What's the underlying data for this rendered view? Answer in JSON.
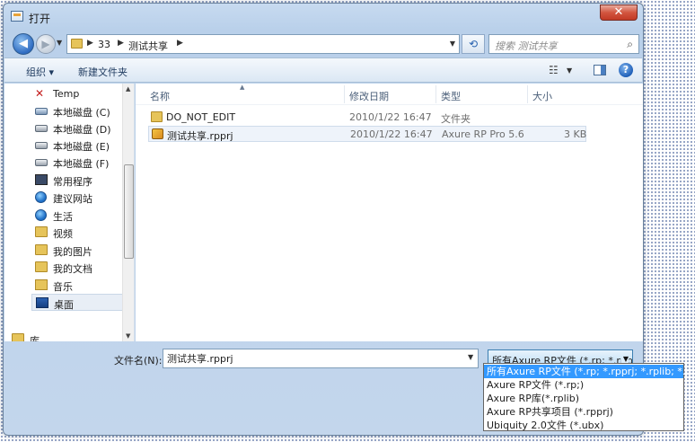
{
  "window": {
    "title": "打开",
    "close_label": "✕"
  },
  "address": {
    "crumbs": [
      "33",
      "测试共享"
    ]
  },
  "search": {
    "placeholder": "搜索 测试共享"
  },
  "toolbar": {
    "organize": "组织 ▾",
    "new_folder": "新建文件夹"
  },
  "nav": {
    "items": [
      {
        "label": "Temp",
        "icon": "temp-x-icon"
      },
      {
        "label": "本地磁盘 (C)",
        "icon": "drive-icon"
      },
      {
        "label": "本地磁盘 (D)",
        "icon": "drive-icon"
      },
      {
        "label": "本地磁盘 (E)",
        "icon": "drive-icon"
      },
      {
        "label": "本地磁盘 (F)",
        "icon": "drive-icon"
      },
      {
        "label": "常用程序",
        "icon": "program-icon"
      },
      {
        "label": "建议网站",
        "icon": "ie-icon"
      },
      {
        "label": "生活",
        "icon": "globe-icon"
      },
      {
        "label": "视频",
        "icon": "folder-icon"
      },
      {
        "label": "我的图片",
        "icon": "folder-icon"
      },
      {
        "label": "我的文档",
        "icon": "folder-icon"
      },
      {
        "label": "音乐",
        "icon": "music-folder-icon"
      },
      {
        "label": "桌面",
        "icon": "desktop-icon"
      },
      {
        "label": "库",
        "icon": "library-icon"
      }
    ]
  },
  "files": {
    "columns": {
      "name": "名称",
      "modified": "修改日期",
      "type": "类型",
      "size": "大小"
    },
    "rows": [
      {
        "name": "DO_NOT_EDIT",
        "modified": "2010/1/22 16:47",
        "type": "文件夹",
        "size": ""
      },
      {
        "name": "测试共享.rpprj",
        "modified": "2010/1/22 16:47",
        "type": "Axure RP Pro 5.6",
        "size": "3 KB"
      }
    ]
  },
  "filename": {
    "label": "文件名(N):",
    "value": "测试共享.rpprj"
  },
  "filetype": {
    "selected": "所有Axure RP文件 (*.rp; *.rpp",
    "options": [
      "所有Axure RP文件 (*.rp; *.rpprj; *.rplib; *.ubx)",
      "Axure RP文件 (*.rp;)",
      "Axure RP库(*.rplib)",
      "Axure RP共享项目 (*.rpprj)",
      "Ubiquity 2.0文件 (*.ubx)"
    ]
  },
  "colors": {
    "selection": "#3399ff",
    "chrome": "#c3d6ec"
  }
}
